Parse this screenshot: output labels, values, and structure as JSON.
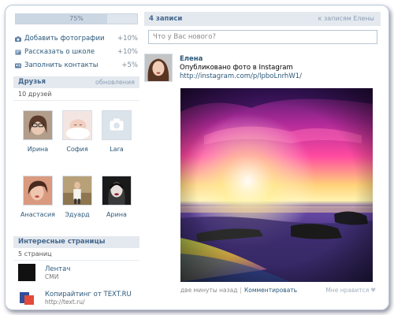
{
  "profile": {
    "progress_pct": 75,
    "progress_label": "75%",
    "tasks": [
      {
        "label": "Добавить фотографии",
        "gain": "+10%",
        "icon": "camera-icon"
      },
      {
        "label": "Рассказать о школе",
        "gain": "+10%",
        "icon": "school-icon"
      },
      {
        "label": "Заполнить контакты",
        "gain": "+5%",
        "icon": "contacts-icon"
      }
    ]
  },
  "friends": {
    "title": "Друзья",
    "updates_link": "обновления",
    "count_label": "10 друзей",
    "items": [
      {
        "name": "Ирина"
      },
      {
        "name": "София"
      },
      {
        "name": "Lara"
      },
      {
        "name": "Анастасия"
      },
      {
        "name": "Эдуард"
      },
      {
        "name": "Арина"
      }
    ]
  },
  "pages": {
    "title": "Интересные страницы",
    "count_label": "5 страниц",
    "items": [
      {
        "name": "Лентач",
        "sub": "СМИ"
      },
      {
        "name": "Копирайтинг от TEXT.RU",
        "sub": "http://text.ru/"
      }
    ]
  },
  "wall": {
    "count_label": "4 записи",
    "filter_link": "к записям Елены",
    "compose_placeholder": "Что у Вас нового?",
    "post": {
      "author": "Елена",
      "text": "Опубликовано фото в Instagram",
      "link": "http://instagram.com/p/lpboLnrhW1/",
      "time": "две минуты назад",
      "comment_label": "Комментировать",
      "like_label": "Мне нравится"
    }
  },
  "colors": {
    "link": "#2b587a",
    "header_bg": "#e4e9ef"
  }
}
